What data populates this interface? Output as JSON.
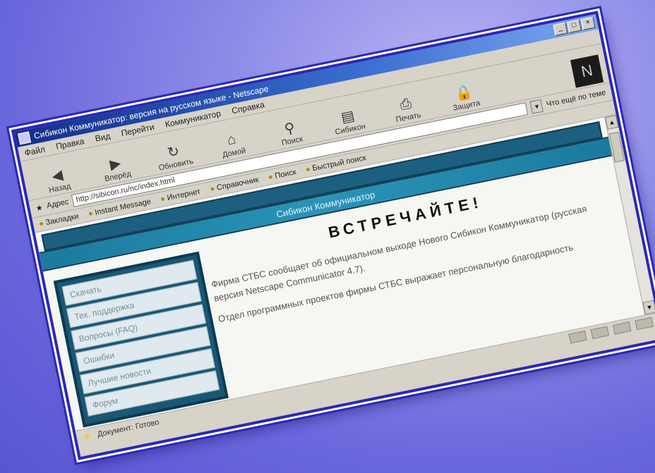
{
  "window": {
    "title": "Сибикон Коммуникатор: версия на русском языке - Netscape",
    "buttons": [
      "_",
      "□",
      "×"
    ]
  },
  "menu": [
    "Файл",
    "Правка",
    "Вид",
    "Перейти",
    "Коммуникатор",
    "Справка"
  ],
  "toolbar": {
    "items": [
      {
        "label": "Назад",
        "icon": "back-icon"
      },
      {
        "label": "Вперёд",
        "icon": "forward-icon"
      },
      {
        "label": "Обновить",
        "icon": "reload-icon"
      },
      {
        "label": "Домой",
        "icon": "home-icon"
      },
      {
        "label": "Поиск",
        "icon": "search-icon"
      },
      {
        "label": "Сибикон",
        "icon": "guide-icon"
      },
      {
        "label": "Печать",
        "icon": "print-icon"
      },
      {
        "label": "Защита",
        "icon": "security-icon"
      }
    ],
    "brand_icon": "netscape-logo-icon"
  },
  "address": {
    "label": "Адрес",
    "value": "http://sibicon.ru/nc/index.html",
    "related_label": "Что ещё по теме"
  },
  "links": [
    "Закладки",
    "Instant Message",
    "Интернет",
    "Справочник",
    "Поиск",
    "Быстрый поиск"
  ],
  "page": {
    "band_title": "Сибикон Коммуникатор",
    "nav": [
      "Скачать",
      "Тех. поддержка",
      "Вопросы (FAQ)",
      "Ошибки",
      "Лучшие новости",
      "Форум"
    ],
    "heading": "ВСТРЕЧАЙТЕ!",
    "paragraphs": [
      "Фирма СТБС сообщает об официальном выходе Нового Сибикон Коммуникатор (русская версия Netscape Communicator 4.7).",
      "Отдел программных проектов фирмы СТБС выражает персональную благодарность"
    ]
  },
  "status": {
    "text": "Документ: Готово"
  }
}
